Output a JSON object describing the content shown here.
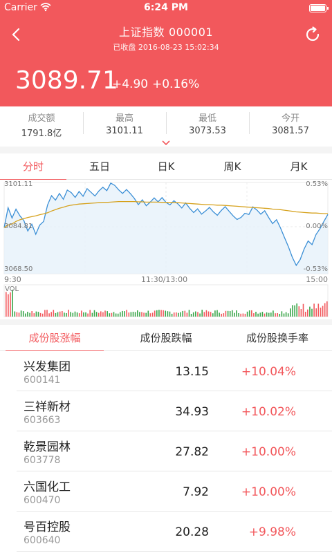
{
  "status_bar": {
    "carrier": "Carrier",
    "time": "6:24 PM"
  },
  "header": {
    "title": "上证指数",
    "code": "000001",
    "subtitle": "已收盘 2016-08-23 15:02:34",
    "price": "3089.71",
    "change": "+4.90",
    "change_pct": "+0.16%"
  },
  "stats": [
    {
      "label": "成交额",
      "value": "1791.8亿"
    },
    {
      "label": "最高",
      "value": "3101.11"
    },
    {
      "label": "最低",
      "value": "3073.53"
    },
    {
      "label": "今开",
      "value": "3081.57"
    }
  ],
  "tabs": [
    {
      "label": "分时",
      "active": true
    },
    {
      "label": "五日",
      "active": false
    },
    {
      "label": "日K",
      "active": false
    },
    {
      "label": "周K",
      "active": false
    },
    {
      "label": "月K",
      "active": false
    }
  ],
  "colors": {
    "accent": "#f2585c",
    "price_line": "#3b8fd6",
    "avg_line": "#d6a21e",
    "vol_up": "#f2585c",
    "vol_down": "#3aa64a"
  },
  "chart_data": {
    "type": "line",
    "y_left_labels": [
      "3101.11",
      "3084.81",
      "3068.50"
    ],
    "y_right_labels": [
      "0.53%",
      "0.00%",
      "-0.53%"
    ],
    "x_labels": [
      "9:30",
      "11:30/13:00",
      "15:00"
    ],
    "ylim": [
      3068.5,
      3101.11
    ],
    "series": [
      {
        "values": [
          3085.0,
          3092.1,
          3088.4,
          3091.6,
          3089.2,
          3087.5,
          3083.8,
          3086.2,
          3082.6,
          3085.9,
          3087.2,
          3093.1,
          3096.4,
          3094.8,
          3097.2,
          3095.1,
          3098.4,
          3097.5,
          3095.8,
          3097.9,
          3096.2,
          3098.9,
          3097.6,
          3096.3,
          3098.1,
          3099.4,
          3098.2,
          3100.9,
          3100.1,
          3098.5,
          3097.2,
          3098.6,
          3097.1,
          3095.4,
          3093.2,
          3094.9,
          3092.8,
          3094.1,
          3095.6,
          3094.2,
          3095.7,
          3094.0,
          3093.1,
          3094.6,
          3093.5,
          3092.0,
          3093.8,
          3091.9,
          3090.4,
          3091.7,
          3089.8,
          3090.9,
          3092.2,
          3090.6,
          3089.4,
          3091.1,
          3092.5,
          3090.8,
          3089.2,
          3087.9,
          3088.6,
          3090.1,
          3089.7,
          3092.4,
          3091.3,
          3089.8,
          3091.0,
          3088.6,
          3086.4,
          3087.8,
          3084.9,
          3081.5,
          3078.2,
          3074.4,
          3071.5,
          3073.6,
          3077.4,
          3080.2,
          3078.9,
          3082.5,
          3084.6,
          3087.2,
          3089.7
        ]
      },
      {
        "values": [
          3085.0,
          3085.9,
          3086.3,
          3087.2,
          3087.8,
          3088.2,
          3088.6,
          3088.9,
          3089.2,
          3089.6,
          3089.9,
          3090.3,
          3090.9,
          3091.4,
          3091.9,
          3092.3,
          3092.7,
          3093.0,
          3093.2,
          3093.4,
          3093.5,
          3093.6,
          3093.7,
          3093.8,
          3093.9,
          3094.0,
          3094.0,
          3094.1,
          3094.2,
          3094.3,
          3094.3,
          3094.3,
          3094.3,
          3094.3,
          3094.2,
          3094.2,
          3094.1,
          3094.1,
          3094.1,
          3094.1,
          3094.0,
          3094.0,
          3094.0,
          3093.9,
          3093.9,
          3093.8,
          3093.7,
          3093.6,
          3093.5,
          3093.4,
          3093.3,
          3093.2,
          3093.2,
          3093.1,
          3093.0,
          3093.0,
          3092.9,
          3092.8,
          3092.7,
          3092.6,
          3092.5,
          3092.4,
          3092.3,
          3092.2,
          3092.1,
          3092.0,
          3091.9,
          3091.8,
          3091.6,
          3091.5,
          3091.4,
          3091.2,
          3091.0,
          3090.8,
          3090.6,
          3090.5,
          3090.4,
          3090.3,
          3090.2,
          3090.2,
          3090.1,
          3090.0,
          3090.0
        ]
      }
    ],
    "volume_label": "VOL"
  },
  "constituent_tabs": [
    {
      "label": "成份股涨幅",
      "active": true
    },
    {
      "label": "成份股跌幅",
      "active": false
    },
    {
      "label": "成份股换手率",
      "active": false
    }
  ],
  "rows": [
    {
      "name": "兴发集团",
      "code": "600141",
      "price": "13.15",
      "pct": "+10.04%"
    },
    {
      "name": "三祥新材",
      "code": "603663",
      "price": "34.93",
      "pct": "+10.02%"
    },
    {
      "name": "乾景园林",
      "code": "603778",
      "price": "27.82",
      "pct": "+10.00%"
    },
    {
      "name": "六国化工",
      "code": "600470",
      "price": "7.92",
      "pct": "+10.00%"
    },
    {
      "name": "号百控股",
      "code": "600640",
      "price": "20.28",
      "pct": "+9.98%"
    }
  ]
}
